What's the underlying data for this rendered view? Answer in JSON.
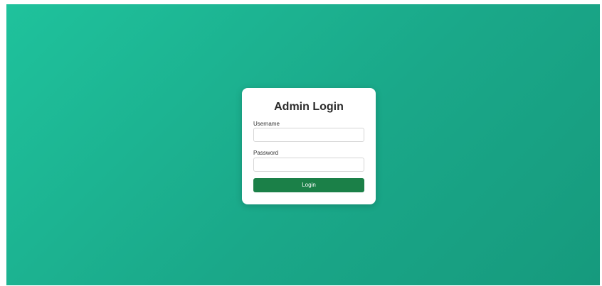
{
  "login": {
    "title": "Admin Login",
    "username_label": "Username",
    "username_value": "",
    "password_label": "Password",
    "password_value": "",
    "submit_label": "Login"
  },
  "colors": {
    "background_start": "#1fc29c",
    "background_end": "#169a7d",
    "button": "#1b8048",
    "card": "#ffffff"
  }
}
